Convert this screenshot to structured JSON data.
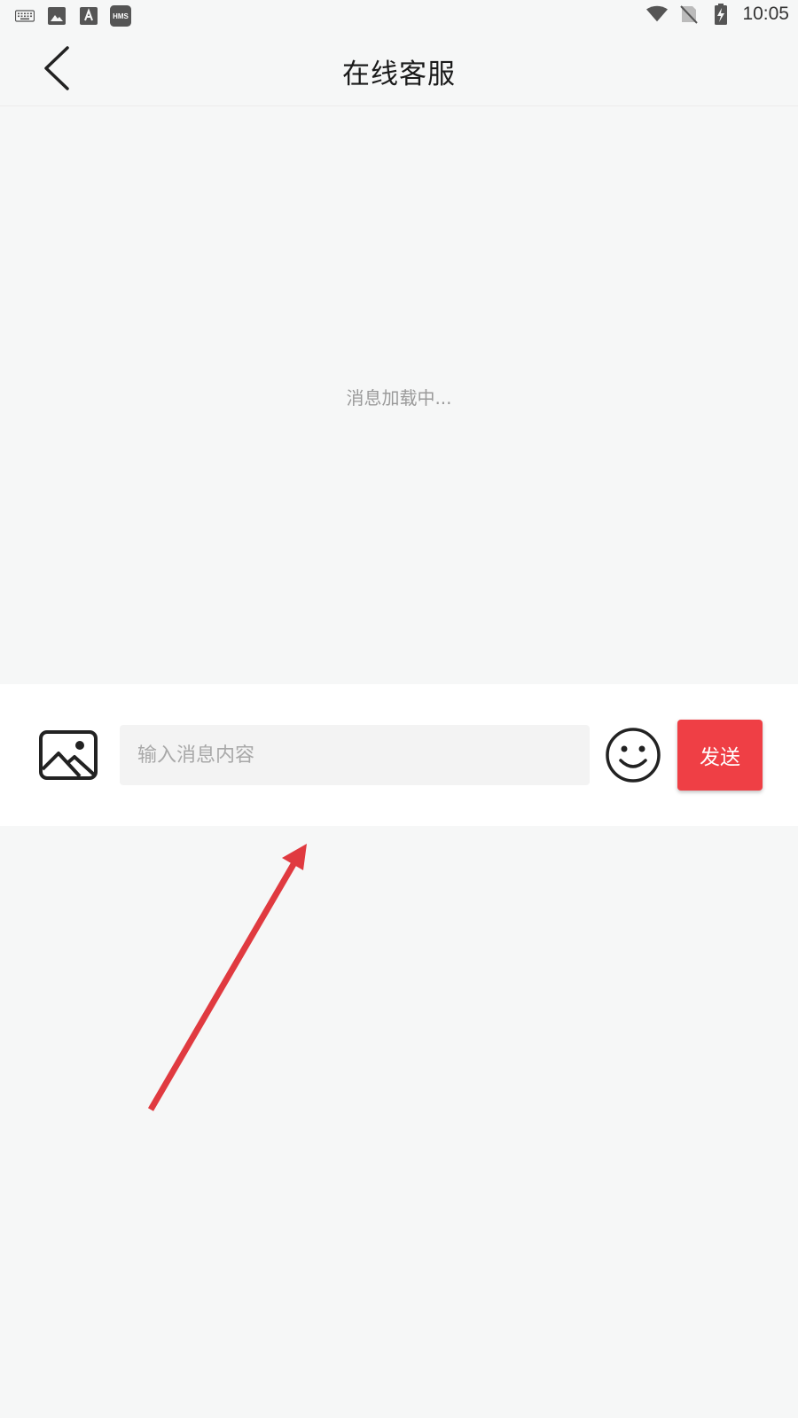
{
  "status_bar": {
    "time": "10:05",
    "left_icons": [
      "keyboard-icon",
      "image-icon",
      "font-icon",
      "hms-icon"
    ],
    "hms_label": "HMS",
    "right_icons": [
      "wifi-icon",
      "no-sim-icon",
      "battery-charging-icon"
    ]
  },
  "header": {
    "title": "在线客服"
  },
  "messages": {
    "loading_text": "消息加载中..."
  },
  "composer": {
    "placeholder": "输入消息内容",
    "value": "",
    "send_label": "发送"
  },
  "colors": {
    "accent": "#ef3f45",
    "background": "#f6f7f7",
    "annotation": "#e03a40"
  }
}
